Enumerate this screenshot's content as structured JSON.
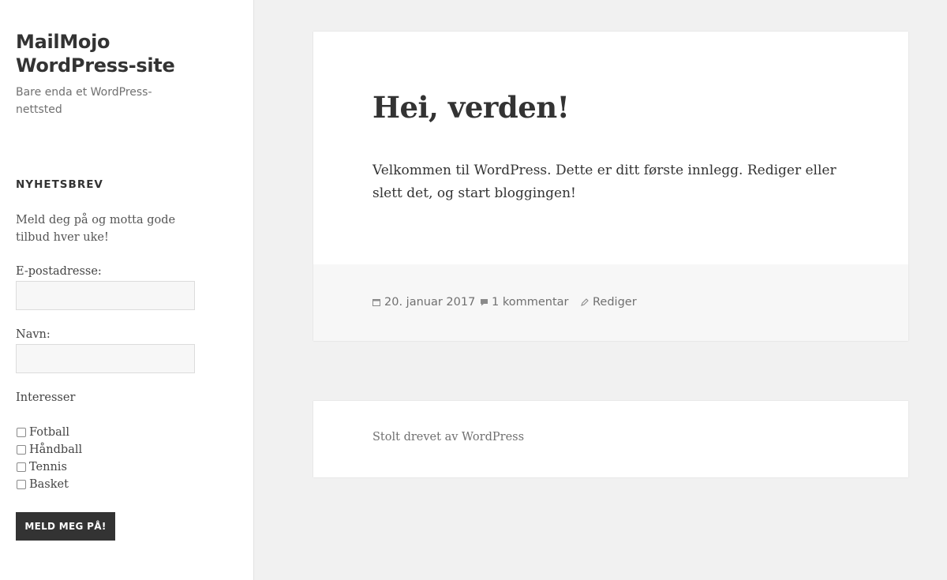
{
  "site": {
    "title": "MailMojo WordPress-site",
    "description": "Bare enda et WordPress-nettsted"
  },
  "newsletter": {
    "title": "NYHETSBREV",
    "intro": "Meld deg på og motta gode tilbud hver uke!",
    "email_label": "E-postadresse:",
    "email_value": "",
    "name_label": "Navn:",
    "name_value": "",
    "interests_label": "Interesser",
    "interests": [
      {
        "label": "Fotball",
        "checked": false
      },
      {
        "label": "Håndball",
        "checked": false
      },
      {
        "label": "Tennis",
        "checked": false
      },
      {
        "label": "Basket",
        "checked": false
      }
    ],
    "submit_label": "MELD MEG PÅ!"
  },
  "post": {
    "title": "Hei, verden!",
    "body": "Velkommen til WordPress. Dette er ditt første innlegg. Rediger eller slett det, og start bloggingen!",
    "meta": {
      "date": "20. januar 2017",
      "comments": "1 kommentar",
      "edit": "Rediger"
    }
  },
  "footer": {
    "credit": "Stolt drevet av WordPress"
  },
  "colors": {
    "background": "#f1f1f1",
    "card": "#ffffff",
    "text": "#333333",
    "muted": "#707070",
    "button": "#333333"
  },
  "icons": [
    "calendar-icon",
    "comment-icon",
    "edit-pencil-icon"
  ]
}
